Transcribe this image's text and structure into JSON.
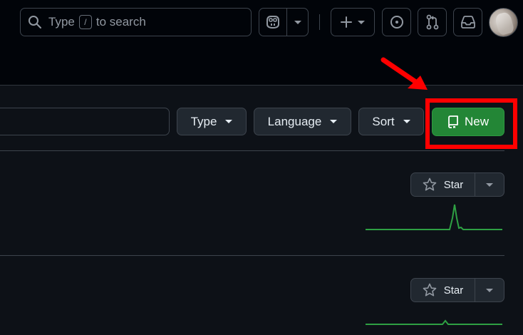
{
  "header": {
    "search": {
      "prefix": "Type",
      "key": "/",
      "suffix": "to search"
    }
  },
  "filters": {
    "type_label": "Type",
    "language_label": "Language",
    "sort_label": "Sort",
    "new_label": "New"
  },
  "repos": [
    {
      "star_label": "Star"
    },
    {
      "star_label": "Star"
    }
  ],
  "colors": {
    "background": "#0d1117",
    "header_background": "#010409",
    "new_button": "#238636",
    "annotation": "#ff0000",
    "sparkline": "#2ea043"
  }
}
